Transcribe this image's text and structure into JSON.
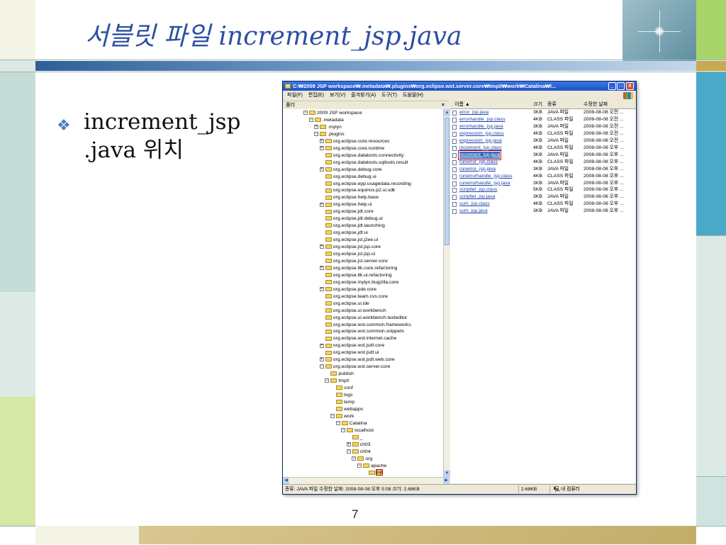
{
  "slide": {
    "title": "서블릿 파일 increment_jsp.java",
    "bullet_line1": "increment_jsp",
    "bullet_line2": ".java 위치",
    "page_number": "7"
  },
  "window": {
    "title": "C:₩2009 JSP workspace₩.metadata₩.plugins₩org.eclipse.wst.server.core₩tmp0₩work₩Catalina₩l...",
    "buttons": {
      "minimize": "_",
      "maximize": "□",
      "close": "X"
    },
    "menu": [
      "파일(F)",
      "편집(E)",
      "보기(V)",
      "즐겨찾기(A)",
      "도구(T)",
      "도움말(H)"
    ],
    "folder_pane": {
      "label": "폴더",
      "close": "×"
    },
    "tree": [
      {
        "label": "2009 JSP workspace",
        "depth": 0,
        "expander": "−"
      },
      {
        "label": ".metadata",
        "depth": 1,
        "expander": "−"
      },
      {
        "label": ".mylyn",
        "depth": 2,
        "expander": "+"
      },
      {
        "label": ".plugins",
        "depth": 2,
        "expander": "−"
      },
      {
        "label": "org.eclipse.core.resources",
        "depth": 3,
        "expander": "+"
      },
      {
        "label": "org.eclipse.core.runtime",
        "depth": 3,
        "expander": "+"
      },
      {
        "label": "org.eclipse.datatools.connectivity",
        "depth": 3,
        "expander": ""
      },
      {
        "label": "org.eclipse.datatools.sqltools.result",
        "depth": 3,
        "expander": ""
      },
      {
        "label": "org.eclipse.debug.core",
        "depth": 3,
        "expander": "+"
      },
      {
        "label": "org.eclipse.debug.ui",
        "depth": 3,
        "expander": ""
      },
      {
        "label": "org.eclipse.epp.usagedata.recording",
        "depth": 3,
        "expander": ""
      },
      {
        "label": "org.eclipse.equinox.p2.ui.sdk",
        "depth": 3,
        "expander": ""
      },
      {
        "label": "org.eclipse.help.base",
        "depth": 3,
        "expander": ""
      },
      {
        "label": "org.eclipse.help.ui",
        "depth": 3,
        "expander": "+"
      },
      {
        "label": "org.eclipse.jdt.core",
        "depth": 3,
        "expander": ""
      },
      {
        "label": "org.eclipse.jdt.debug.ui",
        "depth": 3,
        "expander": ""
      },
      {
        "label": "org.eclipse.jdt.launching",
        "depth": 3,
        "expander": ""
      },
      {
        "label": "org.eclipse.jdt.ui",
        "depth": 3,
        "expander": ""
      },
      {
        "label": "org.eclipse.jst.j2ee.ui",
        "depth": 3,
        "expander": ""
      },
      {
        "label": "org.eclipse.jst.jsp.core",
        "depth": 3,
        "expander": "+"
      },
      {
        "label": "org.eclipse.jst.jsp.ui",
        "depth": 3,
        "expander": ""
      },
      {
        "label": "org.eclipse.jst.server.core",
        "depth": 3,
        "expander": ""
      },
      {
        "label": "org.eclipse.ltk.core.refactoring",
        "depth": 3,
        "expander": "+"
      },
      {
        "label": "org.eclipse.ltk.ui.refactoring",
        "depth": 3,
        "expander": ""
      },
      {
        "label": "org.eclipse.mylyn.bugzilla.core",
        "depth": 3,
        "expander": ""
      },
      {
        "label": "org.eclipse.pde.core",
        "depth": 3,
        "expander": "+"
      },
      {
        "label": "org.eclipse.team.cvs.core",
        "depth": 3,
        "expander": ""
      },
      {
        "label": "org.eclipse.ui.ide",
        "depth": 3,
        "expander": ""
      },
      {
        "label": "org.eclipse.ui.workbench",
        "depth": 3,
        "expander": ""
      },
      {
        "label": "org.eclipse.ui.workbench.texteditor",
        "depth": 3,
        "expander": ""
      },
      {
        "label": "org.eclipse.wst.common.frameworks",
        "depth": 3,
        "expander": ""
      },
      {
        "label": "org.eclipse.wst.common.snippets",
        "depth": 3,
        "expander": ""
      },
      {
        "label": "org.eclipse.wst.internet.cache",
        "depth": 3,
        "expander": ""
      },
      {
        "label": "org.eclipse.wst.jsdt.core",
        "depth": 3,
        "expander": "+"
      },
      {
        "label": "org.eclipse.wst.jsdt.ui",
        "depth": 3,
        "expander": ""
      },
      {
        "label": "org.eclipse.wst.jsdt.web.core",
        "depth": 3,
        "expander": "+"
      },
      {
        "label": "org.eclipse.wst.server.core",
        "depth": 3,
        "expander": "−"
      },
      {
        "label": "publish",
        "depth": 4,
        "expander": ""
      },
      {
        "label": "tmp0",
        "depth": 4,
        "expander": "−"
      },
      {
        "label": "conf",
        "depth": 5,
        "expander": ""
      },
      {
        "label": "logs",
        "depth": 5,
        "expander": ""
      },
      {
        "label": "temp",
        "depth": 5,
        "expander": ""
      },
      {
        "label": "webapps",
        "depth": 5,
        "expander": ""
      },
      {
        "label": "work",
        "depth": 5,
        "expander": "−"
      },
      {
        "label": "Catalina",
        "depth": 6,
        "expander": "−"
      },
      {
        "label": "localhost",
        "depth": 7,
        "expander": "−"
      },
      {
        "label": "_",
        "depth": 8,
        "expander": ""
      },
      {
        "label": "ch03",
        "depth": 8,
        "expander": "+"
      },
      {
        "label": "ch04",
        "depth": 8,
        "expander": "−"
      },
      {
        "label": "org",
        "depth": 9,
        "expander": "−"
      },
      {
        "label": "apache",
        "depth": 10,
        "expander": "−"
      },
      {
        "label": "jsp",
        "depth": 11,
        "expander": "",
        "selected": true
      }
    ],
    "list_columns": {
      "name": "이름 ▲",
      "size": "크기",
      "type": "종류",
      "modified": "수정한 날짜"
    },
    "files": [
      {
        "name": "error_jsp.java",
        "size": "3KB",
        "type": "JAVA 파일",
        "modified": "2008-08-08 오전 ..."
      },
      {
        "name": "errorhandle_jsp.class",
        "size": "4KB",
        "type": "CLASS 파일",
        "modified": "2008-08-08 오전 ..."
      },
      {
        "name": "errorhandle_jsp.java",
        "size": "3KB",
        "type": "JAVA 파일",
        "modified": "2008-08-08 오전 ..."
      },
      {
        "name": "expression_jsp.class",
        "size": "4KB",
        "type": "CLASS 파일",
        "modified": "2008-08-08 오전 ..."
      },
      {
        "name": "expression_jsp.java",
        "size": "3KB",
        "type": "JAVA 파일",
        "modified": "2008-08-08 오전 ..."
      },
      {
        "name": "increment_jsp.class",
        "size": "4KB",
        "type": "CLASS 파일",
        "modified": "2008-08-08 오후 ..."
      },
      {
        "name": "increment_jsp.java",
        "size": "3KB",
        "type": "JAVA 파일",
        "modified": "2008-08-08 오후 ...",
        "highlight": true
      },
      {
        "name": "runerror_jsp.class",
        "size": "4KB",
        "type": "CLASS 파일",
        "modified": "2008-08-08 오후 ..."
      },
      {
        "name": "runerror_jsp.java",
        "size": "3KB",
        "type": "JAVA 파일",
        "modified": "2008-08-08 오후 ..."
      },
      {
        "name": "runerrorhandle_jsp.class",
        "size": "4KB",
        "type": "CLASS 파일",
        "modified": "2008-08-08 오후 ..."
      },
      {
        "name": "runerrorhandle_jsp.java",
        "size": "3KB",
        "type": "JAVA 파일",
        "modified": "2008-08-08 오후 ..."
      },
      {
        "name": "scriptlet_jsp.class",
        "size": "5KB",
        "type": "CLASS 파일",
        "modified": "2008-08-06 오후 ..."
      },
      {
        "name": "scriptlet_jsp.java",
        "size": "3KB",
        "type": "JAVA 파일",
        "modified": "2008-08-06 오후 ..."
      },
      {
        "name": "sum_jsp.class",
        "size": "4KB",
        "type": "CLASS 파일",
        "modified": "2008-08-08 오후 ..."
      },
      {
        "name": "sum_jsp.java",
        "size": "3KB",
        "type": "JAVA 파일",
        "modified": "2008-08-08 오후 ..."
      }
    ],
    "status": {
      "description": "종류: JAVA 파일 수정한 날짜: 2008-08-08 오후 5:08 크기: 2.68KB",
      "size": "2.68KB",
      "location": "내 컴퓨터"
    }
  }
}
